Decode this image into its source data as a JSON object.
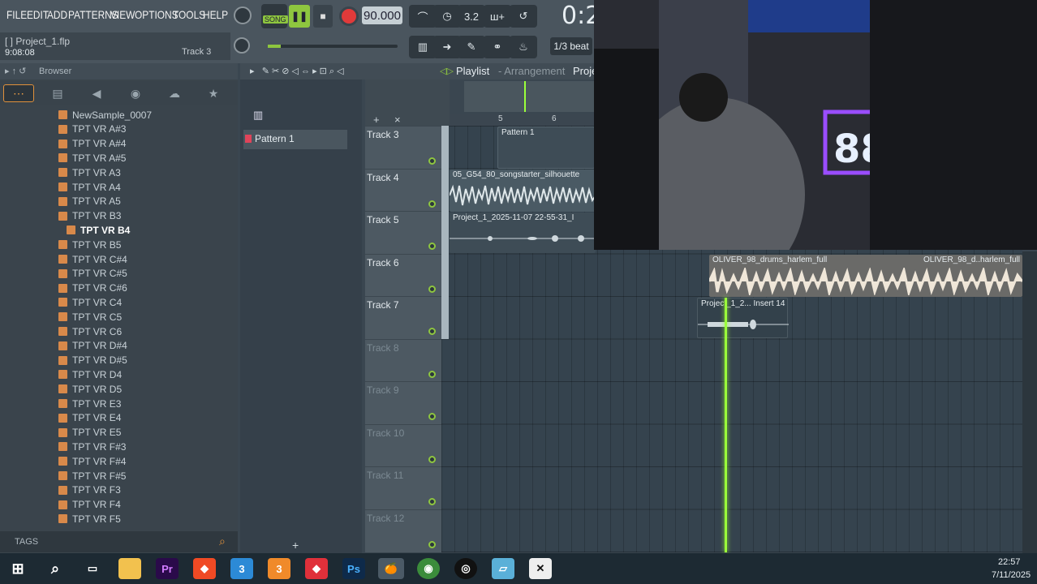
{
  "menu": [
    "FILE",
    "EDIT",
    "ADD",
    "PATTERNS",
    "VIEW",
    "OPTIONS",
    "TOOLS",
    "HELP"
  ],
  "transport": {
    "mode_label": "SONG",
    "tempo": "90.000",
    "time": "0:2"
  },
  "project": {
    "name": "Project_1.flp",
    "time": "9:08:08",
    "track": "Track 3"
  },
  "snap": "1/3 beat",
  "browser": {
    "title": "Browser",
    "files": [
      "NewSample_0007",
      "TPT VR A#3",
      "TPT VR A#4",
      "TPT VR A#5",
      "TPT VR A3",
      "TPT VR A4",
      "TPT VR A5",
      "TPT VR B3",
      "TPT VR B4",
      "TPT VR B5",
      "TPT VR C#4",
      "TPT VR C#5",
      "TPT VR C#6",
      "TPT VR C4",
      "TPT VR C5",
      "TPT VR C6",
      "TPT VR D#4",
      "TPT VR D#5",
      "TPT VR D4",
      "TPT VR D5",
      "TPT VR E3",
      "TPT VR E4",
      "TPT VR E5",
      "TPT VR F#3",
      "TPT VR F#4",
      "TPT VR F#5",
      "TPT VR F3",
      "TPT VR F4",
      "TPT VR F5"
    ],
    "selected_index": 8,
    "tags_label": "TAGS"
  },
  "playlist": {
    "title": "Playlist",
    "subtitle": "- Arrangement",
    "extra": "Proje",
    "pattern": "Pattern 1",
    "bars": [
      "5",
      "6"
    ],
    "tracks": [
      "Track 3",
      "Track 4",
      "Track 5",
      "Track 6",
      "Track 7",
      "Track 8",
      "Track 9",
      "Track 10",
      "Track 11",
      "Track 12"
    ],
    "clips": {
      "pattern": "Pattern 1",
      "t4": "05_G54_80_songstarter_silhouette",
      "t5": "Project_1_2025-11-07 22-55-31_I",
      "t6a": "OLIVER_98_drums_harlem_full",
      "t6b": "OLIVER_98_d..harlem_full",
      "t7": "Project_1_2... Insert 14"
    }
  },
  "taskbar": {
    "time": "22:57",
    "date": "7/11/2025",
    "icons": [
      "windows-start",
      "search",
      "task-view",
      "file-explorer",
      "premiere",
      "brave",
      "app-3",
      "app-3b",
      "anydesk",
      "photoshop",
      "fl-studio",
      "chrome",
      "obs",
      "notes",
      "capcut"
    ]
  }
}
